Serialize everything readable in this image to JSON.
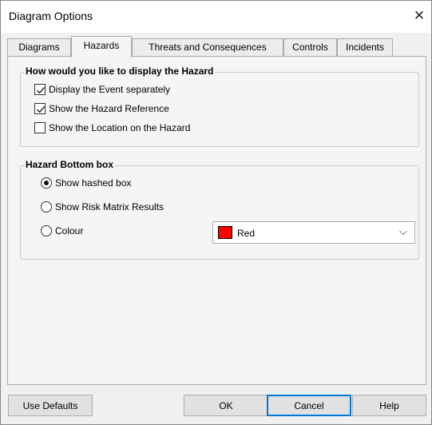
{
  "window": {
    "title": "Diagram Options"
  },
  "tabs": [
    {
      "label": "Diagrams"
    },
    {
      "label": "Hazards"
    },
    {
      "label": "Threats and Consequences"
    },
    {
      "label": "Controls"
    },
    {
      "label": "Incidents"
    }
  ],
  "display_group": {
    "legend": "How would you like to display the Hazard",
    "options": [
      {
        "label": "Display the Event separately",
        "checked": true
      },
      {
        "label": "Show the Hazard Reference",
        "checked": true
      },
      {
        "label": "Show the Location on the Hazard",
        "checked": false
      }
    ]
  },
  "bottom_box_group": {
    "legend": "Hazard Bottom box",
    "options": [
      {
        "label": "Show hashed box",
        "selected": true
      },
      {
        "label": "Show Risk Matrix Results",
        "selected": false
      },
      {
        "label": "Colour",
        "selected": false
      }
    ],
    "colour_select": {
      "value": "Red",
      "swatch_color": "#ff0000"
    }
  },
  "buttons": {
    "use_defaults": "Use Defaults",
    "ok": "OK",
    "cancel": "Cancel",
    "help": "Help"
  },
  "colors": {
    "accent": "#0078d7"
  }
}
